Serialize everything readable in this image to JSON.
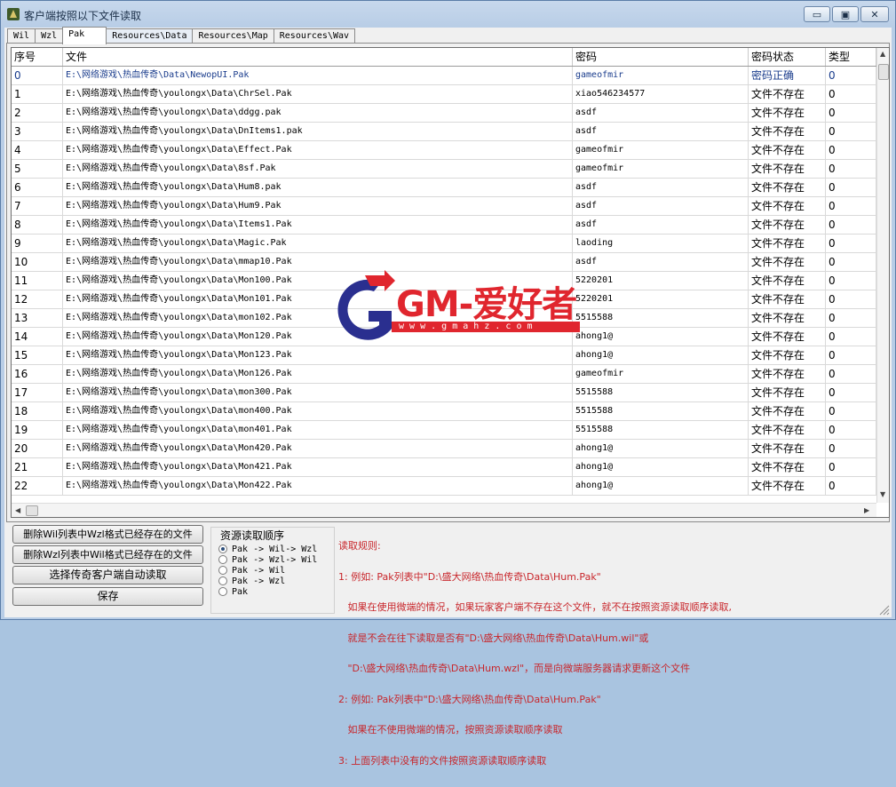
{
  "window": {
    "title": "客户端按照以下文件读取",
    "buttons": {
      "minimize": "▭",
      "maximize": "▣",
      "close": "✕"
    }
  },
  "tabs": [
    {
      "label": "Wil",
      "active": false
    },
    {
      "label": "Wzl",
      "active": false
    },
    {
      "label": "Pak",
      "active": true
    },
    {
      "label": "Resources\\Data",
      "active": false
    },
    {
      "label": "Resources\\Map",
      "active": false
    },
    {
      "label": "Resources\\Wav",
      "active": false
    }
  ],
  "table": {
    "columns": [
      "序号",
      "文件",
      "密码",
      "密码状态",
      "类型"
    ],
    "rows": [
      [
        "0",
        "E:\\网络游戏\\热血传奇\\Data\\NewopUI.Pak",
        "gameofmir",
        "密码正确",
        "0"
      ],
      [
        "1",
        "E:\\网络游戏\\热血传奇\\youlongx\\Data\\ChrSel.Pak",
        "xiao546234577",
        "文件不存在",
        "0"
      ],
      [
        "2",
        "E:\\网络游戏\\热血传奇\\youlongx\\Data\\ddgg.pak",
        "asdf",
        "文件不存在",
        "0"
      ],
      [
        "3",
        "E:\\网络游戏\\热血传奇\\youlongx\\Data\\DnItems1.pak",
        "asdf",
        "文件不存在",
        "0"
      ],
      [
        "4",
        "E:\\网络游戏\\热血传奇\\youlongx\\Data\\Effect.Pak",
        "gameofmir",
        "文件不存在",
        "0"
      ],
      [
        "5",
        "E:\\网络游戏\\热血传奇\\youlongx\\Data\\8sf.Pak",
        "gameofmir",
        "文件不存在",
        "0"
      ],
      [
        "6",
        "E:\\网络游戏\\热血传奇\\youlongx\\Data\\Hum8.pak",
        "asdf",
        "文件不存在",
        "0"
      ],
      [
        "7",
        "E:\\网络游戏\\热血传奇\\youlongx\\Data\\Hum9.Pak",
        "asdf",
        "文件不存在",
        "0"
      ],
      [
        "8",
        "E:\\网络游戏\\热血传奇\\youlongx\\Data\\Items1.Pak",
        "asdf",
        "文件不存在",
        "0"
      ],
      [
        "9",
        "E:\\网络游戏\\热血传奇\\youlongx\\Data\\Magic.Pak",
        "laoding",
        "文件不存在",
        "0"
      ],
      [
        "10",
        "E:\\网络游戏\\热血传奇\\youlongx\\Data\\mmap10.Pak",
        "asdf",
        "文件不存在",
        "0"
      ],
      [
        "11",
        "E:\\网络游戏\\热血传奇\\youlongx\\Data\\Mon100.Pak",
        "5220201",
        "文件不存在",
        "0"
      ],
      [
        "12",
        "E:\\网络游戏\\热血传奇\\youlongx\\Data\\Mon101.Pak",
        "5220201",
        "文件不存在",
        "0"
      ],
      [
        "13",
        "E:\\网络游戏\\热血传奇\\youlongx\\Data\\mon102.Pak",
        "5515588",
        "文件不存在",
        "0"
      ],
      [
        "14",
        "E:\\网络游戏\\热血传奇\\youlongx\\Data\\Mon120.Pak",
        "ahong1@",
        "文件不存在",
        "0"
      ],
      [
        "15",
        "E:\\网络游戏\\热血传奇\\youlongx\\Data\\Mon123.Pak",
        "ahong1@",
        "文件不存在",
        "0"
      ],
      [
        "16",
        "E:\\网络游戏\\热血传奇\\youlongx\\Data\\Mon126.Pak",
        "gameofmir",
        "文件不存在",
        "0"
      ],
      [
        "17",
        "E:\\网络游戏\\热血传奇\\youlongx\\Data\\mon300.Pak",
        "5515588",
        "文件不存在",
        "0"
      ],
      [
        "18",
        "E:\\网络游戏\\热血传奇\\youlongx\\Data\\mon400.Pak",
        "5515588",
        "文件不存在",
        "0"
      ],
      [
        "19",
        "E:\\网络游戏\\热血传奇\\youlongx\\Data\\mon401.Pak",
        "5515588",
        "文件不存在",
        "0"
      ],
      [
        "20",
        "E:\\网络游戏\\热血传奇\\youlongx\\Data\\Mon420.Pak",
        "ahong1@",
        "文件不存在",
        "0"
      ],
      [
        "21",
        "E:\\网络游戏\\热血传奇\\youlongx\\Data\\Mon421.Pak",
        "ahong1@",
        "文件不存在",
        "0"
      ],
      [
        "22",
        "E:\\网络游戏\\热血传奇\\youlongx\\Data\\Mon422.Pak",
        "ahong1@",
        "文件不存在",
        "0"
      ]
    ]
  },
  "watermark": {
    "brand": "GM-爱好者",
    "url": "w w w . g m a h z . c o m"
  },
  "buttons": {
    "delete_wil": "删除Wil列表中Wzl格式已经存在的文件",
    "delete_wzl": "删除Wzl列表中Wil格式已经存在的文件",
    "auto_read": "选择传奇客户端自动读取",
    "save": "保存"
  },
  "read_order": {
    "title": "资源读取顺序",
    "options": [
      {
        "label": "Pak -> Wil-> Wzl",
        "checked": true
      },
      {
        "label": "Pak -> Wzl-> Wil",
        "checked": false
      },
      {
        "label": "Pak -> Wil",
        "checked": false
      },
      {
        "label": "Pak -> Wzl",
        "checked": false
      },
      {
        "label": "Pak",
        "checked": false
      }
    ]
  },
  "rules": {
    "lines": [
      "读取规则:",
      "1: 例如: Pak列表中\"D:\\盛大网络\\热血传奇\\Data\\Hum.Pak\"",
      "   如果在使用微端的情况，如果玩家客户端不存在这个文件，就不在按照资源读取顺序读取,",
      "   就是不会在往下读取是否有\"D:\\盛大网络\\热血传奇\\Data\\Hum.wil\"或",
      "   \"D:\\盛大网络\\热血传奇\\Data\\Hum.wzl\"，而是向微端服务器请求更新这个文件",
      "2: 例如: Pak列表中\"D:\\盛大网络\\热血传奇\\Data\\Hum.Pak\"",
      "   如果在不使用微端的情况，按照资源读取顺序读取",
      "3: 上面列表中没有的文件按照资源读取顺序读取"
    ]
  },
  "colors": {
    "accent": "#1a3c8c",
    "rules": "#c8262b",
    "logo_red": "#e0262e",
    "logo_blue": "#2a2f8f"
  }
}
